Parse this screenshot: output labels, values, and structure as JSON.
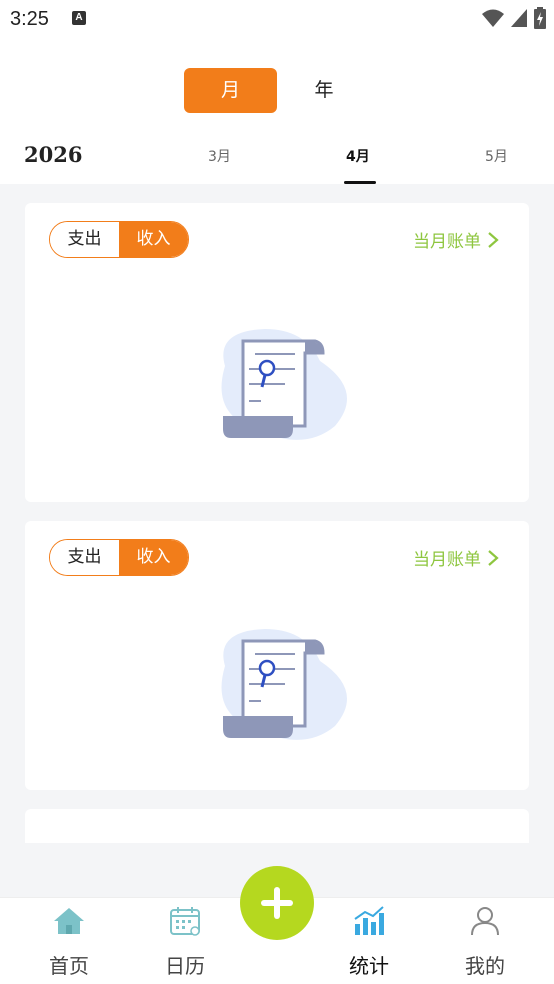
{
  "status": {
    "time": "3:25",
    "notif_letter": "A"
  },
  "header": {
    "period_tabs": {
      "month": "月",
      "year": "年"
    },
    "year": "2026",
    "months": [
      "3月",
      "4月",
      "5月"
    ]
  },
  "cards": [
    {
      "toggle_expense": "支出",
      "toggle_income": "收入",
      "bill_link": "当月账单"
    },
    {
      "toggle_expense": "支出",
      "toggle_income": "收入",
      "bill_link": "当月账单"
    }
  ],
  "nav": {
    "home": "首页",
    "calendar": "日历",
    "stats": "统计",
    "mine": "我的"
  },
  "colors": {
    "accent": "#f27d1a",
    "green": "#8ec63f",
    "add": "#b5d81f",
    "nav_icon": "#7cc2c8"
  }
}
